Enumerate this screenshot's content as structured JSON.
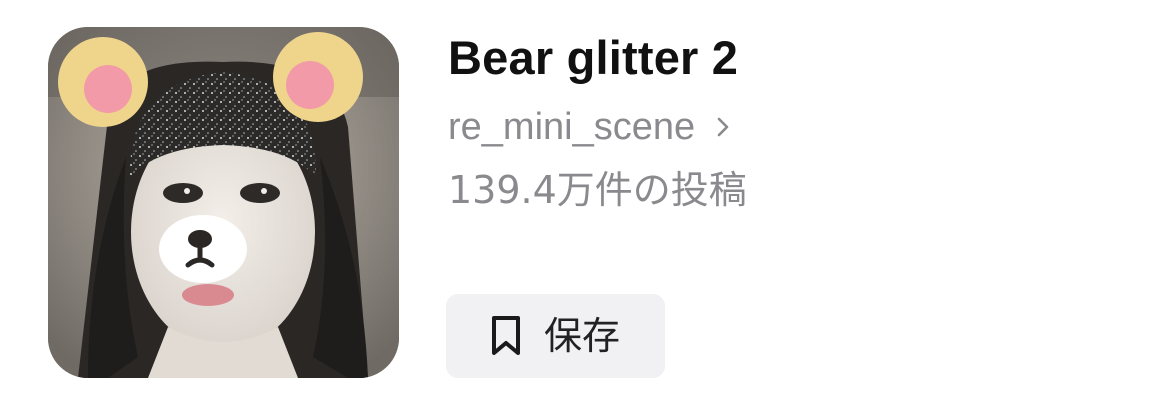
{
  "effect": {
    "title": "Bear glitter 2",
    "creator": "re_mini_scene",
    "post_count": "139.4万件の投稿",
    "thumbnail_alt": "bear-ears-glitter-face-effect-preview"
  },
  "actions": {
    "save_label": "保存",
    "save_icon": "bookmark-icon"
  },
  "icons": {
    "creator_chevron": "chevron-right-icon"
  },
  "colors": {
    "title": "#111111",
    "secondary_text": "#8a8a8e",
    "button_background": "#f1f1f3",
    "ear_outer": "#f0d68c",
    "ear_inner": "#f39aa8"
  }
}
